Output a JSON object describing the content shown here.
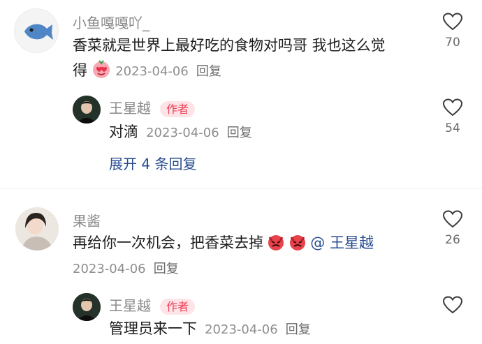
{
  "comments": [
    {
      "user": "小鱼嘎嘎吖_",
      "text_line1": "香菜就是世界上最好吃的食物对吗哥 我也这么觉",
      "text_line2": "得",
      "date": "2023-04-06",
      "reply_label": "回复",
      "likes": "70",
      "replies": [
        {
          "user": "王星越",
          "badge": "作者",
          "text": "对滴",
          "date": "2023-04-06",
          "reply_label": "回复",
          "likes": "54"
        }
      ],
      "expand_label": "展开 4 条回复"
    },
    {
      "user": "果酱",
      "text": "再给你一次机会，把香菜去掉",
      "mention": "@ 王星越",
      "date": "2023-04-06",
      "reply_label": "回复",
      "likes": "26",
      "replies": [
        {
          "user": "王星越",
          "badge": "作者",
          "text": "管理员来一下",
          "date": "2023-04-06",
          "reply_label": "回复"
        }
      ]
    }
  ],
  "colors": {
    "accent_link": "#274a8f",
    "badge_text": "#ef3f56",
    "badge_bg": "#fde4e7"
  }
}
